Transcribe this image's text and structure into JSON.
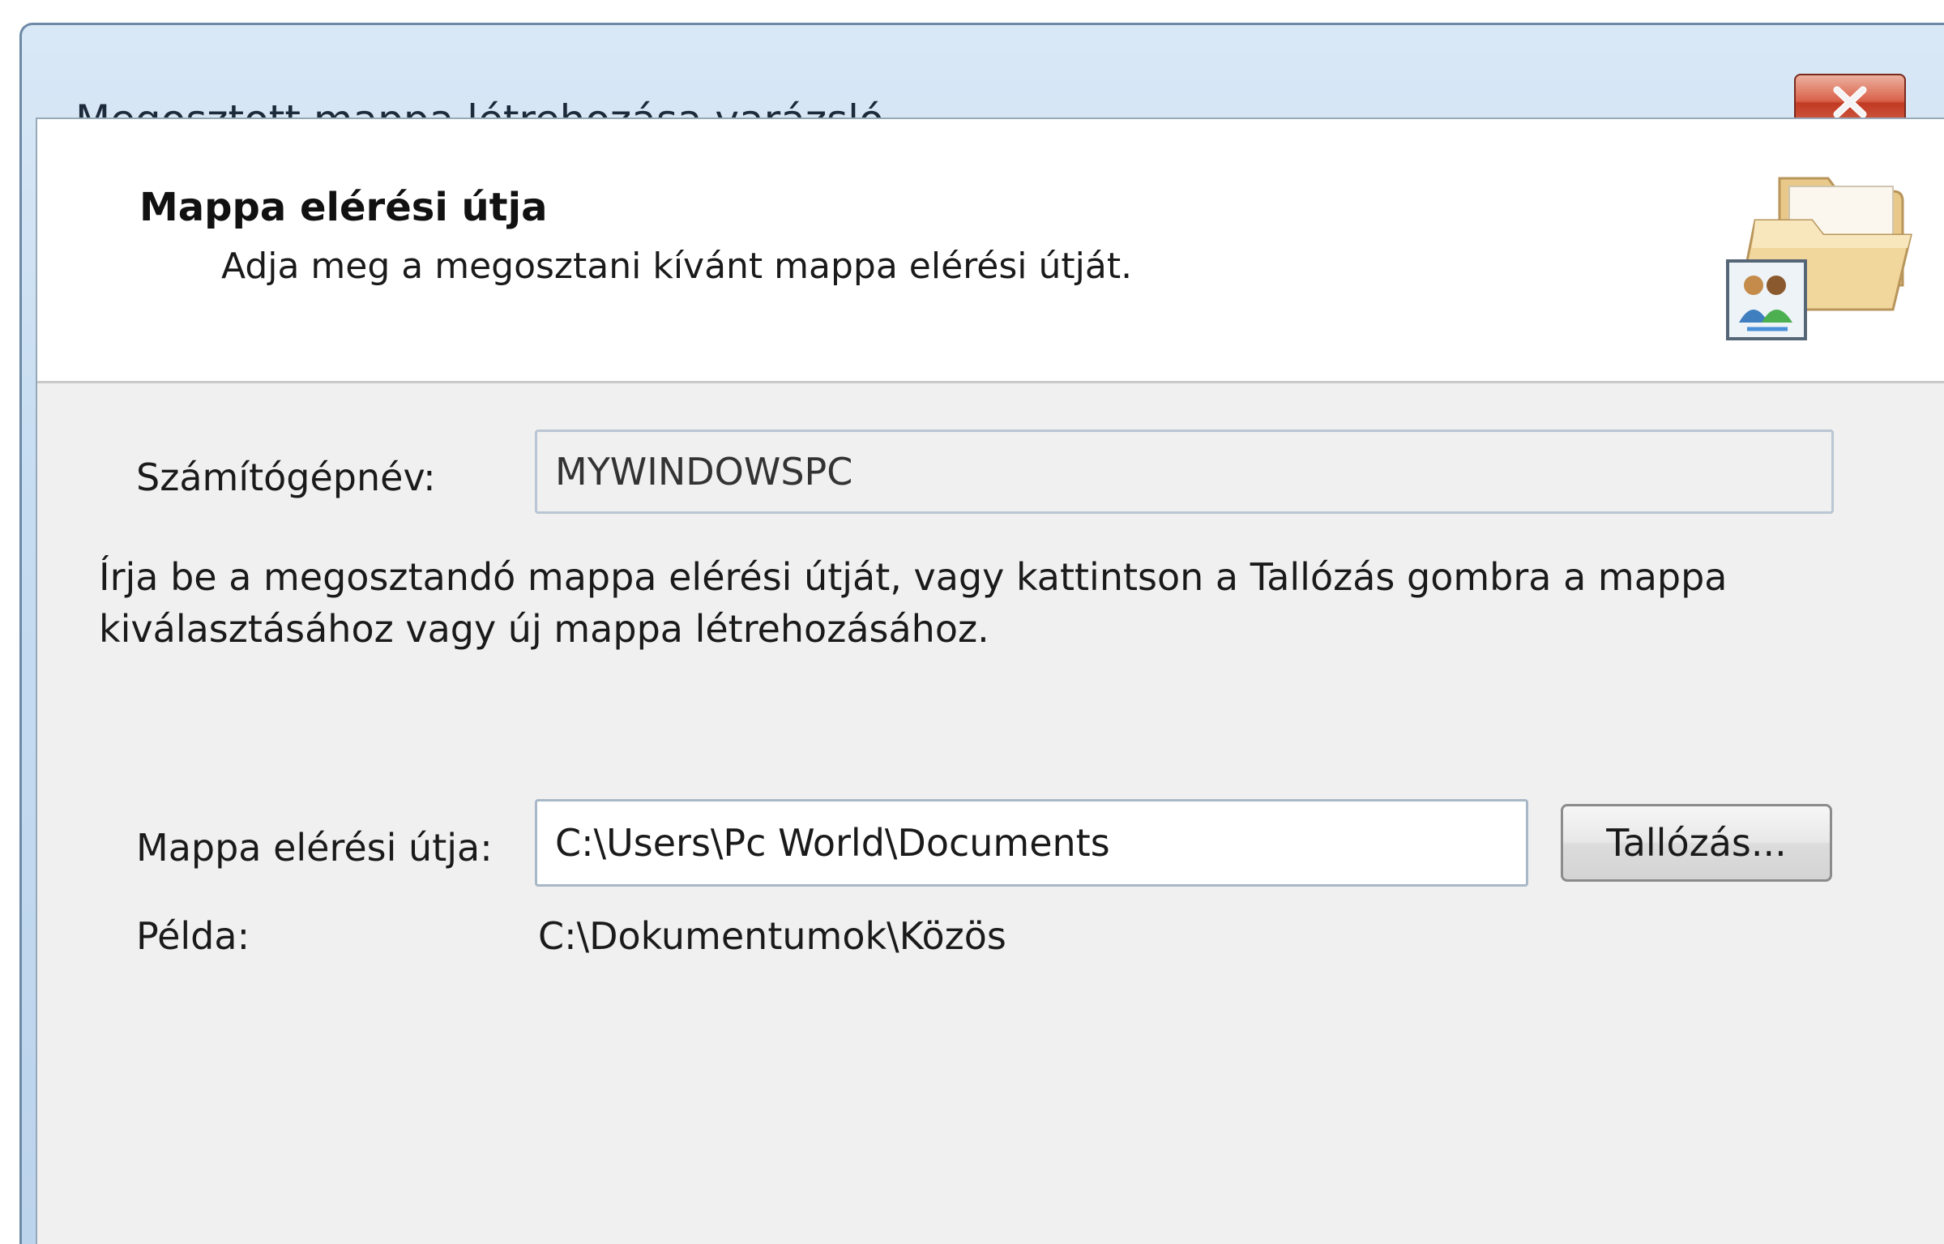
{
  "window": {
    "title": "Megosztott mappa létrehozása varázsló"
  },
  "header": {
    "title": "Mappa elérési útja",
    "subtitle": "Adja meg a megosztani kívánt mappa elérési útját."
  },
  "computer": {
    "label": "Számítógépnév:",
    "value": "MYWINDOWSPC"
  },
  "instruction": "Írja be a megosztandó mappa elérési útját, vagy kattintson a Tallózás gombra a mappa\nkiválasztásához vagy új mappa létrehozásához.",
  "folder_path": {
    "label": "Mappa elérési útja:",
    "value": "C:\\Users\\Pc World\\Documents",
    "browse_label": "Tallózás..."
  },
  "example": {
    "label": "Példa:",
    "value": "C:\\Dokumentumok\\Közös"
  },
  "icons": {
    "close": "close-icon",
    "header": "shared-folder-icon"
  }
}
